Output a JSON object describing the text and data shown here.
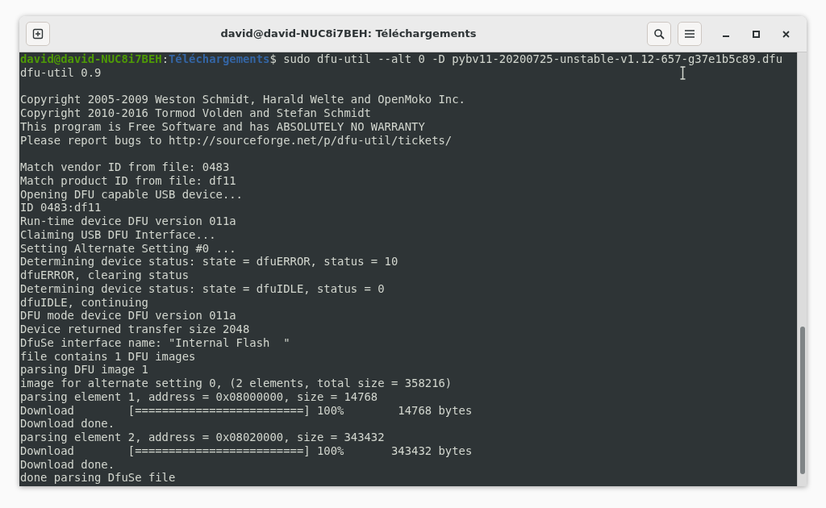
{
  "window": {
    "title": "david@david-NUC8i7BEH: Téléchargements"
  },
  "terminal": {
    "lines": [
      {
        "kind": "prompt",
        "user": "david@david-NUC8i7BEH",
        "separator": ":",
        "path": "Téléchargements",
        "command": "$ sudo dfu-util --alt 0 -D pybv11-20200725-unstable-v1.12-657-g37e1b5c89.dfu"
      },
      {
        "kind": "output",
        "text": "dfu-util 0.9"
      },
      {
        "kind": "blank"
      },
      {
        "kind": "output",
        "text": "Copyright 2005-2009 Weston Schmidt, Harald Welte and OpenMoko Inc."
      },
      {
        "kind": "output",
        "text": "Copyright 2010-2016 Tormod Volden and Stefan Schmidt"
      },
      {
        "kind": "output",
        "text": "This program is Free Software and has ABSOLUTELY NO WARRANTY"
      },
      {
        "kind": "output",
        "text": "Please report bugs to http://sourceforge.net/p/dfu-util/tickets/"
      },
      {
        "kind": "blank"
      },
      {
        "kind": "output",
        "text": "Match vendor ID from file: 0483"
      },
      {
        "kind": "output",
        "text": "Match product ID from file: df11"
      },
      {
        "kind": "output",
        "text": "Opening DFU capable USB device..."
      },
      {
        "kind": "output",
        "text": "ID 0483:df11"
      },
      {
        "kind": "output",
        "text": "Run-time device DFU version 011a"
      },
      {
        "kind": "output",
        "text": "Claiming USB DFU Interface..."
      },
      {
        "kind": "output",
        "text": "Setting Alternate Setting #0 ..."
      },
      {
        "kind": "output",
        "text": "Determining device status: state = dfuERROR, status = 10"
      },
      {
        "kind": "output",
        "text": "dfuERROR, clearing status"
      },
      {
        "kind": "output",
        "text": "Determining device status: state = dfuIDLE, status = 0"
      },
      {
        "kind": "output",
        "text": "dfuIDLE, continuing"
      },
      {
        "kind": "output",
        "text": "DFU mode device DFU version 011a"
      },
      {
        "kind": "output",
        "text": "Device returned transfer size 2048"
      },
      {
        "kind": "output",
        "text": "DfuSe interface name: \"Internal Flash  \""
      },
      {
        "kind": "output",
        "text": "file contains 1 DFU images"
      },
      {
        "kind": "output",
        "text": "parsing DFU image 1"
      },
      {
        "kind": "output",
        "text": "image for alternate setting 0, (2 elements, total size = 358216)"
      },
      {
        "kind": "output",
        "text": "parsing element 1, address = 0x08000000, size = 14768"
      },
      {
        "kind": "output",
        "text": "Download\t[=========================] 100%        14768 bytes"
      },
      {
        "kind": "output",
        "text": "Download done."
      },
      {
        "kind": "output",
        "text": "parsing element 2, address = 0x08020000, size = 343432"
      },
      {
        "kind": "output",
        "text": "Download\t[=========================] 100%       343432 bytes"
      },
      {
        "kind": "output",
        "text": "Download done."
      },
      {
        "kind": "output",
        "text": "done parsing DfuSe file"
      }
    ]
  }
}
